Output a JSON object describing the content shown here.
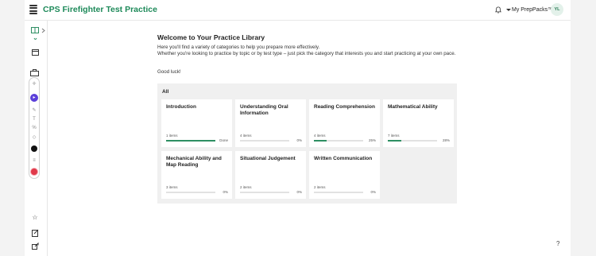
{
  "header": {
    "title": "CPS Firefighter Test Practice",
    "my_link": "My PrepPacks™",
    "avatar_initials": "YL"
  },
  "main": {
    "welcome_title": "Welcome to Your Practice Library",
    "intro_1": "Here you'll find a variety of categories to help you prepare more effectively.",
    "intro_2": "Whether you're looking to practice by topic or by test type – just pick the category that interests you and start practicing at your own pace.",
    "good_luck": "Good luck!",
    "library_label": "All",
    "help": "?"
  },
  "categories": [
    {
      "title": "Introduction",
      "items": "1 items",
      "progress_label": "Done",
      "progress": 1.0
    },
    {
      "title": "Understanding Oral Information",
      "items": "4 items",
      "progress_label": "0%",
      "progress": 0.0
    },
    {
      "title": "Reading Comprehension",
      "items": "4 items",
      "progress_label": "25%",
      "progress": 0.25
    },
    {
      "title": "Mathematical Ability",
      "items": "7 items",
      "progress_label": "28%",
      "progress": 0.28
    },
    {
      "title": "Mechanical Ability and Map Reading",
      "items": "3 items",
      "progress_label": "0%",
      "progress": 0.0
    },
    {
      "title": "Situational Judgement",
      "items": "2 items",
      "progress_label": "0%",
      "progress": 0.0
    },
    {
      "title": "Written Communication",
      "items": "2 items",
      "progress_label": "0%",
      "progress": 0.0
    }
  ],
  "colors": {
    "brand": "#1e8a5a",
    "progress": "#2e8f63",
    "library_bg": "#f0f0f0",
    "tool_purple": "#5b3fd9",
    "tool_red": "#e0394a"
  },
  "icons": {
    "menu": "hamburger-icon",
    "notifications": "bell-icon",
    "sidebar": [
      "book-icon",
      "calendar-icon",
      "tools-icon",
      "star-icon",
      "notebook-icon",
      "export-icon"
    ]
  }
}
